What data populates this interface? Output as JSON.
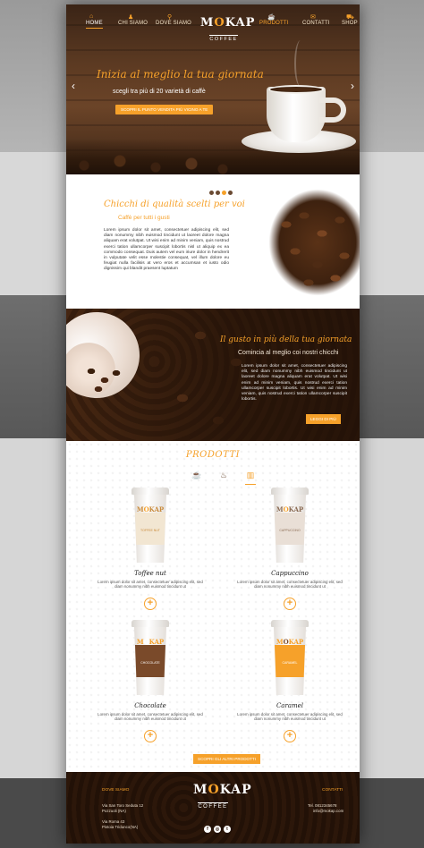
{
  "nav": {
    "items": [
      {
        "label": "HOME",
        "icon": "home-icon"
      },
      {
        "label": "CHI SIAMO",
        "icon": "users-icon"
      },
      {
        "label": "DOVE SIAMO",
        "icon": "map-pin-icon"
      },
      {
        "label": "PRODOTTI",
        "icon": "coffee-cup-icon"
      },
      {
        "label": "CONTATTI",
        "icon": "mail-icon"
      },
      {
        "label": "SHOP",
        "icon": "bag-icon"
      }
    ]
  },
  "brand": {
    "name_a": "M",
    "name_o": "O",
    "name_b": "KAP",
    "sub": "COFFEE"
  },
  "hero": {
    "title": "Inizia al meglio la tua giornata",
    "subtitle": "scegli tra più di 20 varietà di caffè",
    "button": "SCOPRI IL PUNTO VENDITA PIÙ VICINO A TE",
    "prev_icon": "chevron-left-icon",
    "next_icon": "chevron-right-icon"
  },
  "quality": {
    "title": "Chicchi di qualità scelti per voi",
    "subtitle": "Caffè per tutti i gusti",
    "body": "Lorem ipsum dolor sit amet, consectetuer adipiscing elit, sed diam nonummy nibh euismod tincidunt ut laoreet dolore magna aliquam erat volutpat. Ut wisi enim ad minim veniam, quis nostrud exerci tation ullamcorper suscipit lobortis nisl ut aliquip ex ea commodo consequat. Duis autem vel eum iriure dolor in hendrerit in vulputate velit esse molestie consequat, vel illum dolore eu feugiat nulla facilisis at vero eros et accumsan et iusto odio dignissim qui blandit praesent luptatum"
  },
  "taste": {
    "title": "Il gusto in più della tua giornata",
    "subtitle": "Comincia al meglio coi nostri chicchi",
    "body": "Lorem ipsum dolor sit amet, consectetuer adipiscing elit, sed diam nonummy nibh euismod tincidunt ut laoreet dolore magna aliquam erat volutpat. Ut wisi enim ad minim veniam, quis nostrud exerci tation ullamcorper suscipit lobortis. Ut wisi enim ad minim veniam, quis nostrud exerci tation ullamcorper suscipit lobortis.",
    "button": "LEGGI DI PIÙ"
  },
  "products": {
    "title": "PRODOTTI",
    "categories": [
      "coffee-cup-icon",
      "mug-icon",
      "takeaway-cup-icon"
    ],
    "items": [
      {
        "name": "Toffee nut",
        "label": "TOFFEE NUT",
        "band": "#f2e6d2",
        "labelcolor": "#c98a3a",
        "desc": "Lorem ipsum dolor sit amet, consectetuer adipiscing elit, sed diam nonummy nibh euismod tincidunt ut"
      },
      {
        "name": "Cappuccino",
        "label": "CAPPUCCINO",
        "band": "#e9dfd6",
        "labelcolor": "#8a6a52",
        "desc": "Lorem ipsum dolor sit amet, consectetuer adipiscing elit, sed diam nonummy nibh euismod tincidunt ut"
      },
      {
        "name": "Chocolate",
        "label": "CHOCOLATE",
        "band": "#7a4a2a",
        "labelcolor": "#ffffff",
        "desc": "Lorem ipsum dolor sit amet, consectetuer adipiscing elit, sed diam nonummy nibh euismod tincidunt ut"
      },
      {
        "name": "Caramel",
        "label": "CARAMEL",
        "band": "#f6a12a",
        "labelcolor": "#ffffff",
        "desc": "Lorem ipsum dolor sit amet, consectetuer adipiscing elit, sed diam nonummy nibh euismod tincidunt ut"
      }
    ],
    "button": "SCOPRI GLI ALTRI PRODOTTI"
  },
  "footer": {
    "where_title": "DOVE SIAMO",
    "addr1": "Via San Toro Seduta 12",
    "city1": "Pozzuoli (NA)",
    "addr2": "Via Roma 43",
    "city2": "Pistoia Tridunco(NA)",
    "contacts_title": "CONTATTI",
    "phone": "Tel. 0812345678",
    "mail": "info@mokap.com",
    "socials": [
      "f",
      "◎",
      "t"
    ]
  },
  "colors": {
    "accent": "#f6a12a",
    "brown": "#3a1f0e"
  }
}
